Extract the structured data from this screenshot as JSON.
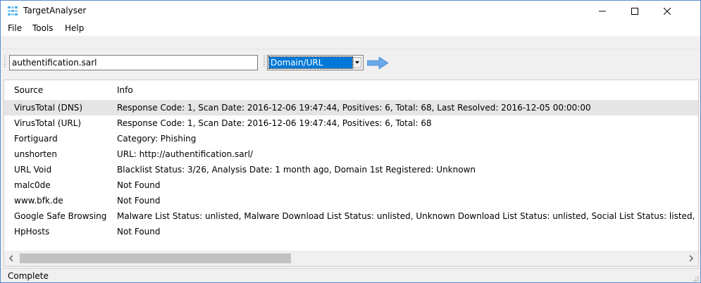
{
  "window": {
    "title": "TargetAnalyser"
  },
  "menu": {
    "items": [
      "File",
      "Tools",
      "Help"
    ]
  },
  "toolbar": {
    "search_value": "authentification.sarl",
    "type_selected": "Domain/URL"
  },
  "list": {
    "columns": [
      "Source",
      "Info"
    ],
    "rows": [
      {
        "source": "VirusTotal (DNS)",
        "info": "Response Code: 1, Scan Date: 2016-12-06 19:47:44, Positives: 6, Total: 68, Last Resolved: 2016-12-05 00:00:00"
      },
      {
        "source": "VirusTotal (URL)",
        "info": "Response Code: 1, Scan Date: 2016-12-06 19:47:44, Positives: 6, Total: 68"
      },
      {
        "source": "Fortiguard",
        "info": "Category: Phishing"
      },
      {
        "source": "unshorten",
        "info": "URL: http://authentification.sarl/"
      },
      {
        "source": "URL Void",
        "info": "Blacklist Status: 3/26, Analysis Date: 1 month ago, Domain 1st Registered: Unknown"
      },
      {
        "source": "malc0de",
        "info": "Not Found"
      },
      {
        "source": "www.bfk.de",
        "info": "Not Found"
      },
      {
        "source": "Google Safe Browsing",
        "info": "Malware List Status: unlisted, Malware Download List Status: unlisted, Unknown Download List Status: unlisted, Social List Status: listed, D"
      },
      {
        "source": "HpHosts",
        "info": "Not Found"
      }
    ]
  },
  "status": {
    "text": "Complete"
  },
  "icons": {
    "app": "app-icon",
    "minimize": "minimize-icon",
    "maximize": "maximize-icon",
    "close": "close-icon",
    "go": "arrow-right-icon",
    "dropdown": "chevron-down-icon",
    "scroll_left": "chevron-left-icon",
    "scroll_right": "chevron-right-icon"
  },
  "colors": {
    "selection": "#0078d7",
    "arrow": "#6aa9e9",
    "row_highlight": "#e5e5e5"
  }
}
